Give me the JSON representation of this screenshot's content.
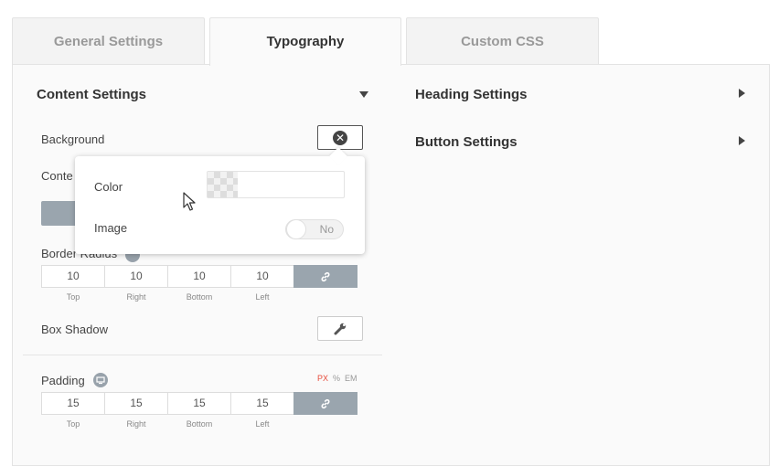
{
  "tabs": [
    {
      "label": "General Settings"
    },
    {
      "label": "Typography"
    },
    {
      "label": "Custom CSS"
    }
  ],
  "content_settings": {
    "title": "Content Settings",
    "background_label": "Background",
    "content_label_partial": "Conte",
    "border_radius_label": "Border Radius",
    "border_radius": {
      "values": [
        "10",
        "10",
        "10",
        "10"
      ],
      "sides": [
        "Top",
        "Right",
        "Bottom",
        "Left"
      ]
    },
    "box_shadow_label": "Box Shadow",
    "padding_label": "Padding",
    "padding_units": [
      "PX",
      "%",
      "EM"
    ],
    "padding": {
      "values": [
        "15",
        "15",
        "15",
        "15"
      ],
      "sides": [
        "Top",
        "Right",
        "Bottom",
        "Left"
      ]
    }
  },
  "right_sections": {
    "heading": "Heading Settings",
    "button": "Button Settings"
  },
  "background_popover": {
    "color_label": "Color",
    "image_label": "Image",
    "image_toggle": "No"
  },
  "colors": {
    "link_button": "#9aa5ae",
    "active_unit": "#e74c3c"
  }
}
